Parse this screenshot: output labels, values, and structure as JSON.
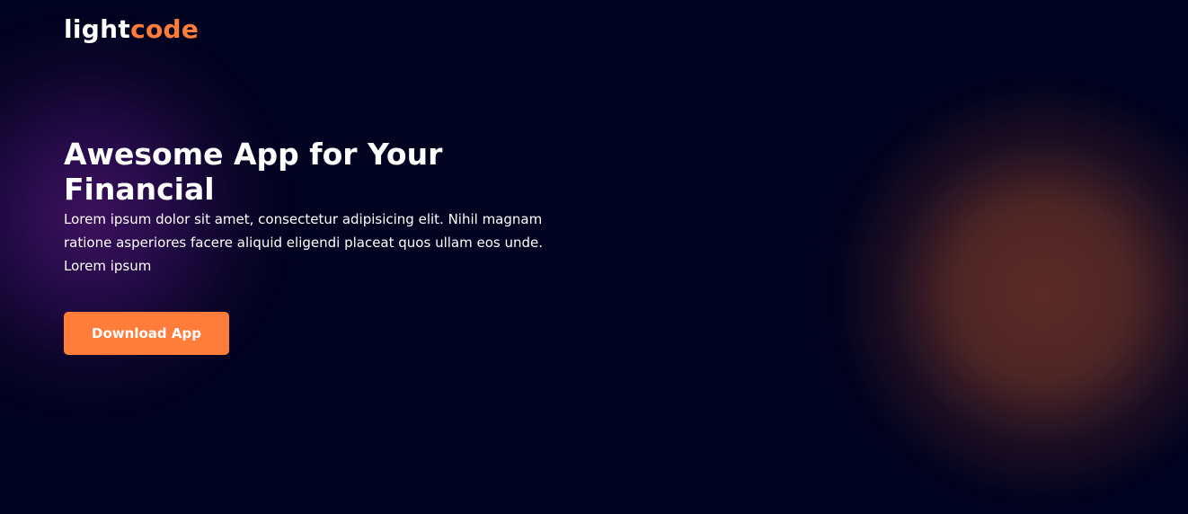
{
  "brand": {
    "logo_part1": "light",
    "logo_part2": "code",
    "accent_color": "#ff7c3b",
    "background_color": "#020320"
  },
  "hero": {
    "title": "Awesome App for Your Financial",
    "description": "Lorem ipsum dolor sit amet, consectetur adipisicing elit. Nihil magnam ratione asperiores facere aliquid eligendi placeat quos ullam eos unde. Lorem ipsum",
    "cta_label": "Download App"
  }
}
